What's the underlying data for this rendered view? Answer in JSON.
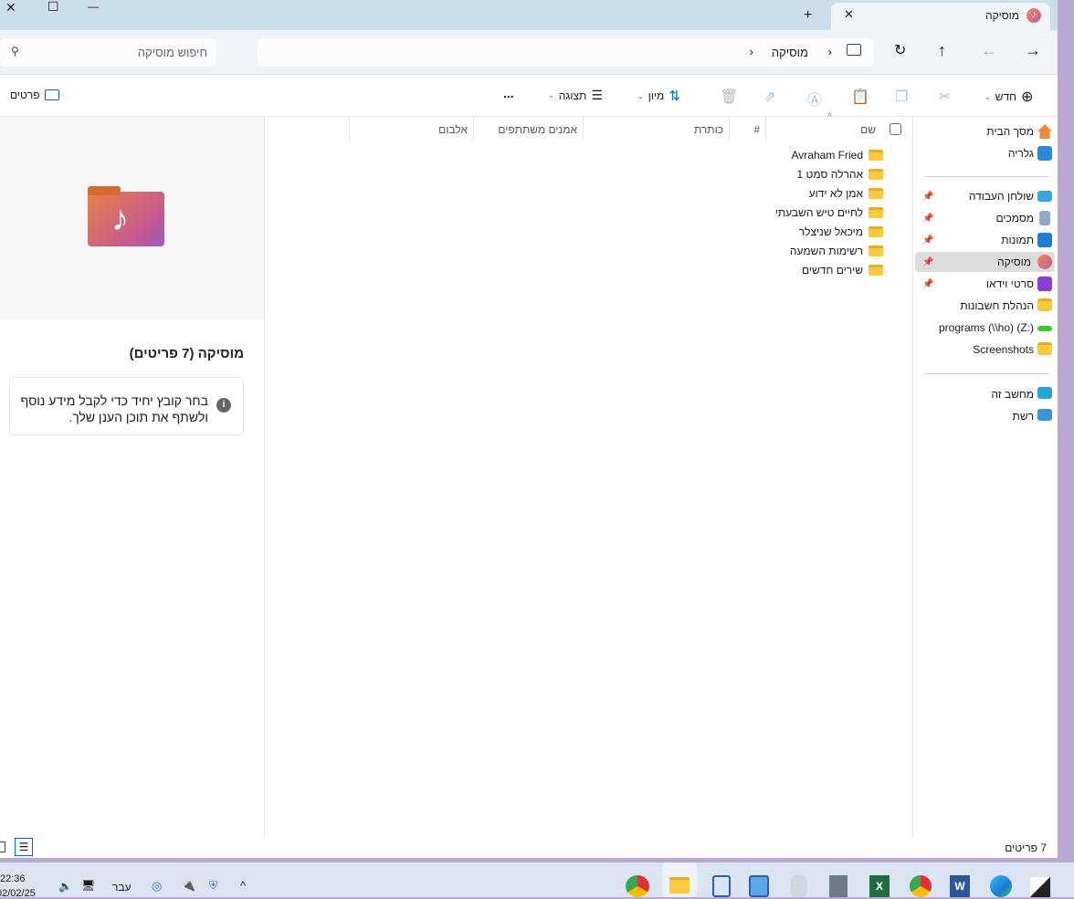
{
  "window": {
    "tab_title": "מוסיקה",
    "new_tab": "+",
    "close_tab": "✕",
    "minimize": "—",
    "maximize": "☐",
    "close": "✕"
  },
  "address": {
    "breadcrumb": [
      "מוסיקה"
    ],
    "search_placeholder": "חיפוש מוסיקה"
  },
  "toolbar": {
    "new_label": "חדש",
    "sort_label": "מיון",
    "view_label": "תצוגה",
    "more": "...",
    "details_label": "פרטים"
  },
  "sidebar": {
    "top": [
      {
        "label": "מסך הבית",
        "icon": "home-icon"
      },
      {
        "label": "גלריה",
        "icon": "gallery-icon"
      }
    ],
    "pinned": [
      {
        "label": "שולחן העבודה",
        "icon": "desktop-icon",
        "pinned": true
      },
      {
        "label": "מסמכים",
        "icon": "documents-icon",
        "pinned": true
      },
      {
        "label": "תמונות",
        "icon": "pictures-icon",
        "pinned": true
      },
      {
        "label": "מוסיקה",
        "icon": "music-icon",
        "pinned": true,
        "selected": true
      },
      {
        "label": "סרטי וידאו",
        "icon": "videos-icon",
        "pinned": true
      },
      {
        "label": "הנהלת חשבונות",
        "icon": "folder-icon"
      },
      {
        "label": "programs (\\\\ho) (Z:)",
        "icon": "network-drive-icon"
      },
      {
        "label": "Screenshots",
        "icon": "folder-icon"
      }
    ],
    "bottom": [
      {
        "label": "מחשב זה",
        "icon": "computer-icon"
      },
      {
        "label": "רשת",
        "icon": "network-icon"
      }
    ]
  },
  "columns": [
    "שם",
    "#",
    "כותרת",
    "אמנים משתתפים",
    "אלבום"
  ],
  "files": [
    "Avraham Fried",
    "אהרלה סמט 1",
    "אמן לא ידוע",
    "לחיים טיש השבעתי",
    "מיכאל שניצלר",
    "רשימות השמעה",
    "שירים חדשים"
  ],
  "details": {
    "title": "מוסיקה (7 פריטים)",
    "info": "בחר קובץ יחיד כדי לקבל מידע נוסף ולשתף את תוכן הענן שלך."
  },
  "status": {
    "count": "7 פריטים"
  },
  "taskbar": {
    "time": "22:36",
    "date": "02/02/25",
    "lang": "עבר"
  },
  "colors": {
    "accent": "#0067c0",
    "selected": "#dcdcdc"
  }
}
